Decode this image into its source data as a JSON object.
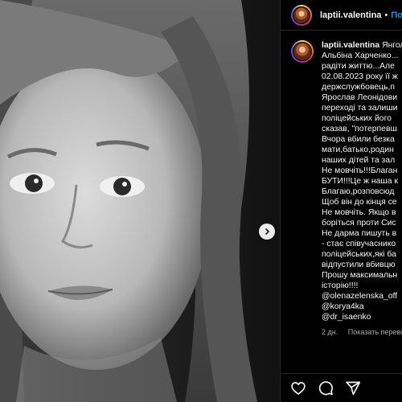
{
  "post": {
    "username": "laptii.valentina",
    "follow_label": "Подписаться"
  },
  "caption": {
    "username": "laptii.valentina",
    "first_line_rest": "Янгол",
    "lines": [
      "Альбіна Харченко...",
      "радіти життю...Але",
      "02.08.2023 року її ж",
      "держслужбовець,п",
      "Ярослав Леонідови",
      "переході та залиши",
      "поліцейських його",
      "сказав, \"потерпевш",
      "Вчора вбили безка",
      "мати,батько,родин",
      "наших дітей та зал",
      "Не мовчіть!!!Благан",
      "БУТИ!!!Це ж наша к",
      "Благаю,розповсюд",
      "Щоб він до кінця се",
      "Не мовчіть. Якщо в",
      "боріться проти Сис",
      "Не дарма пишуть в",
      "- стає співучаснико",
      "поліцейських,які ба",
      "відпустили вбивцю",
      "Прошу максимальн",
      "історію!!!!",
      "@olenazelenska_off",
      "@korya4ka",
      "@dr_isaenko"
    ],
    "time": "2 дн.",
    "translate_label": "Показать перевод"
  },
  "icons": {
    "next": "chevron-right-icon",
    "like": "heart-icon",
    "comment": "comment-icon",
    "share": "paper-plane-icon"
  }
}
